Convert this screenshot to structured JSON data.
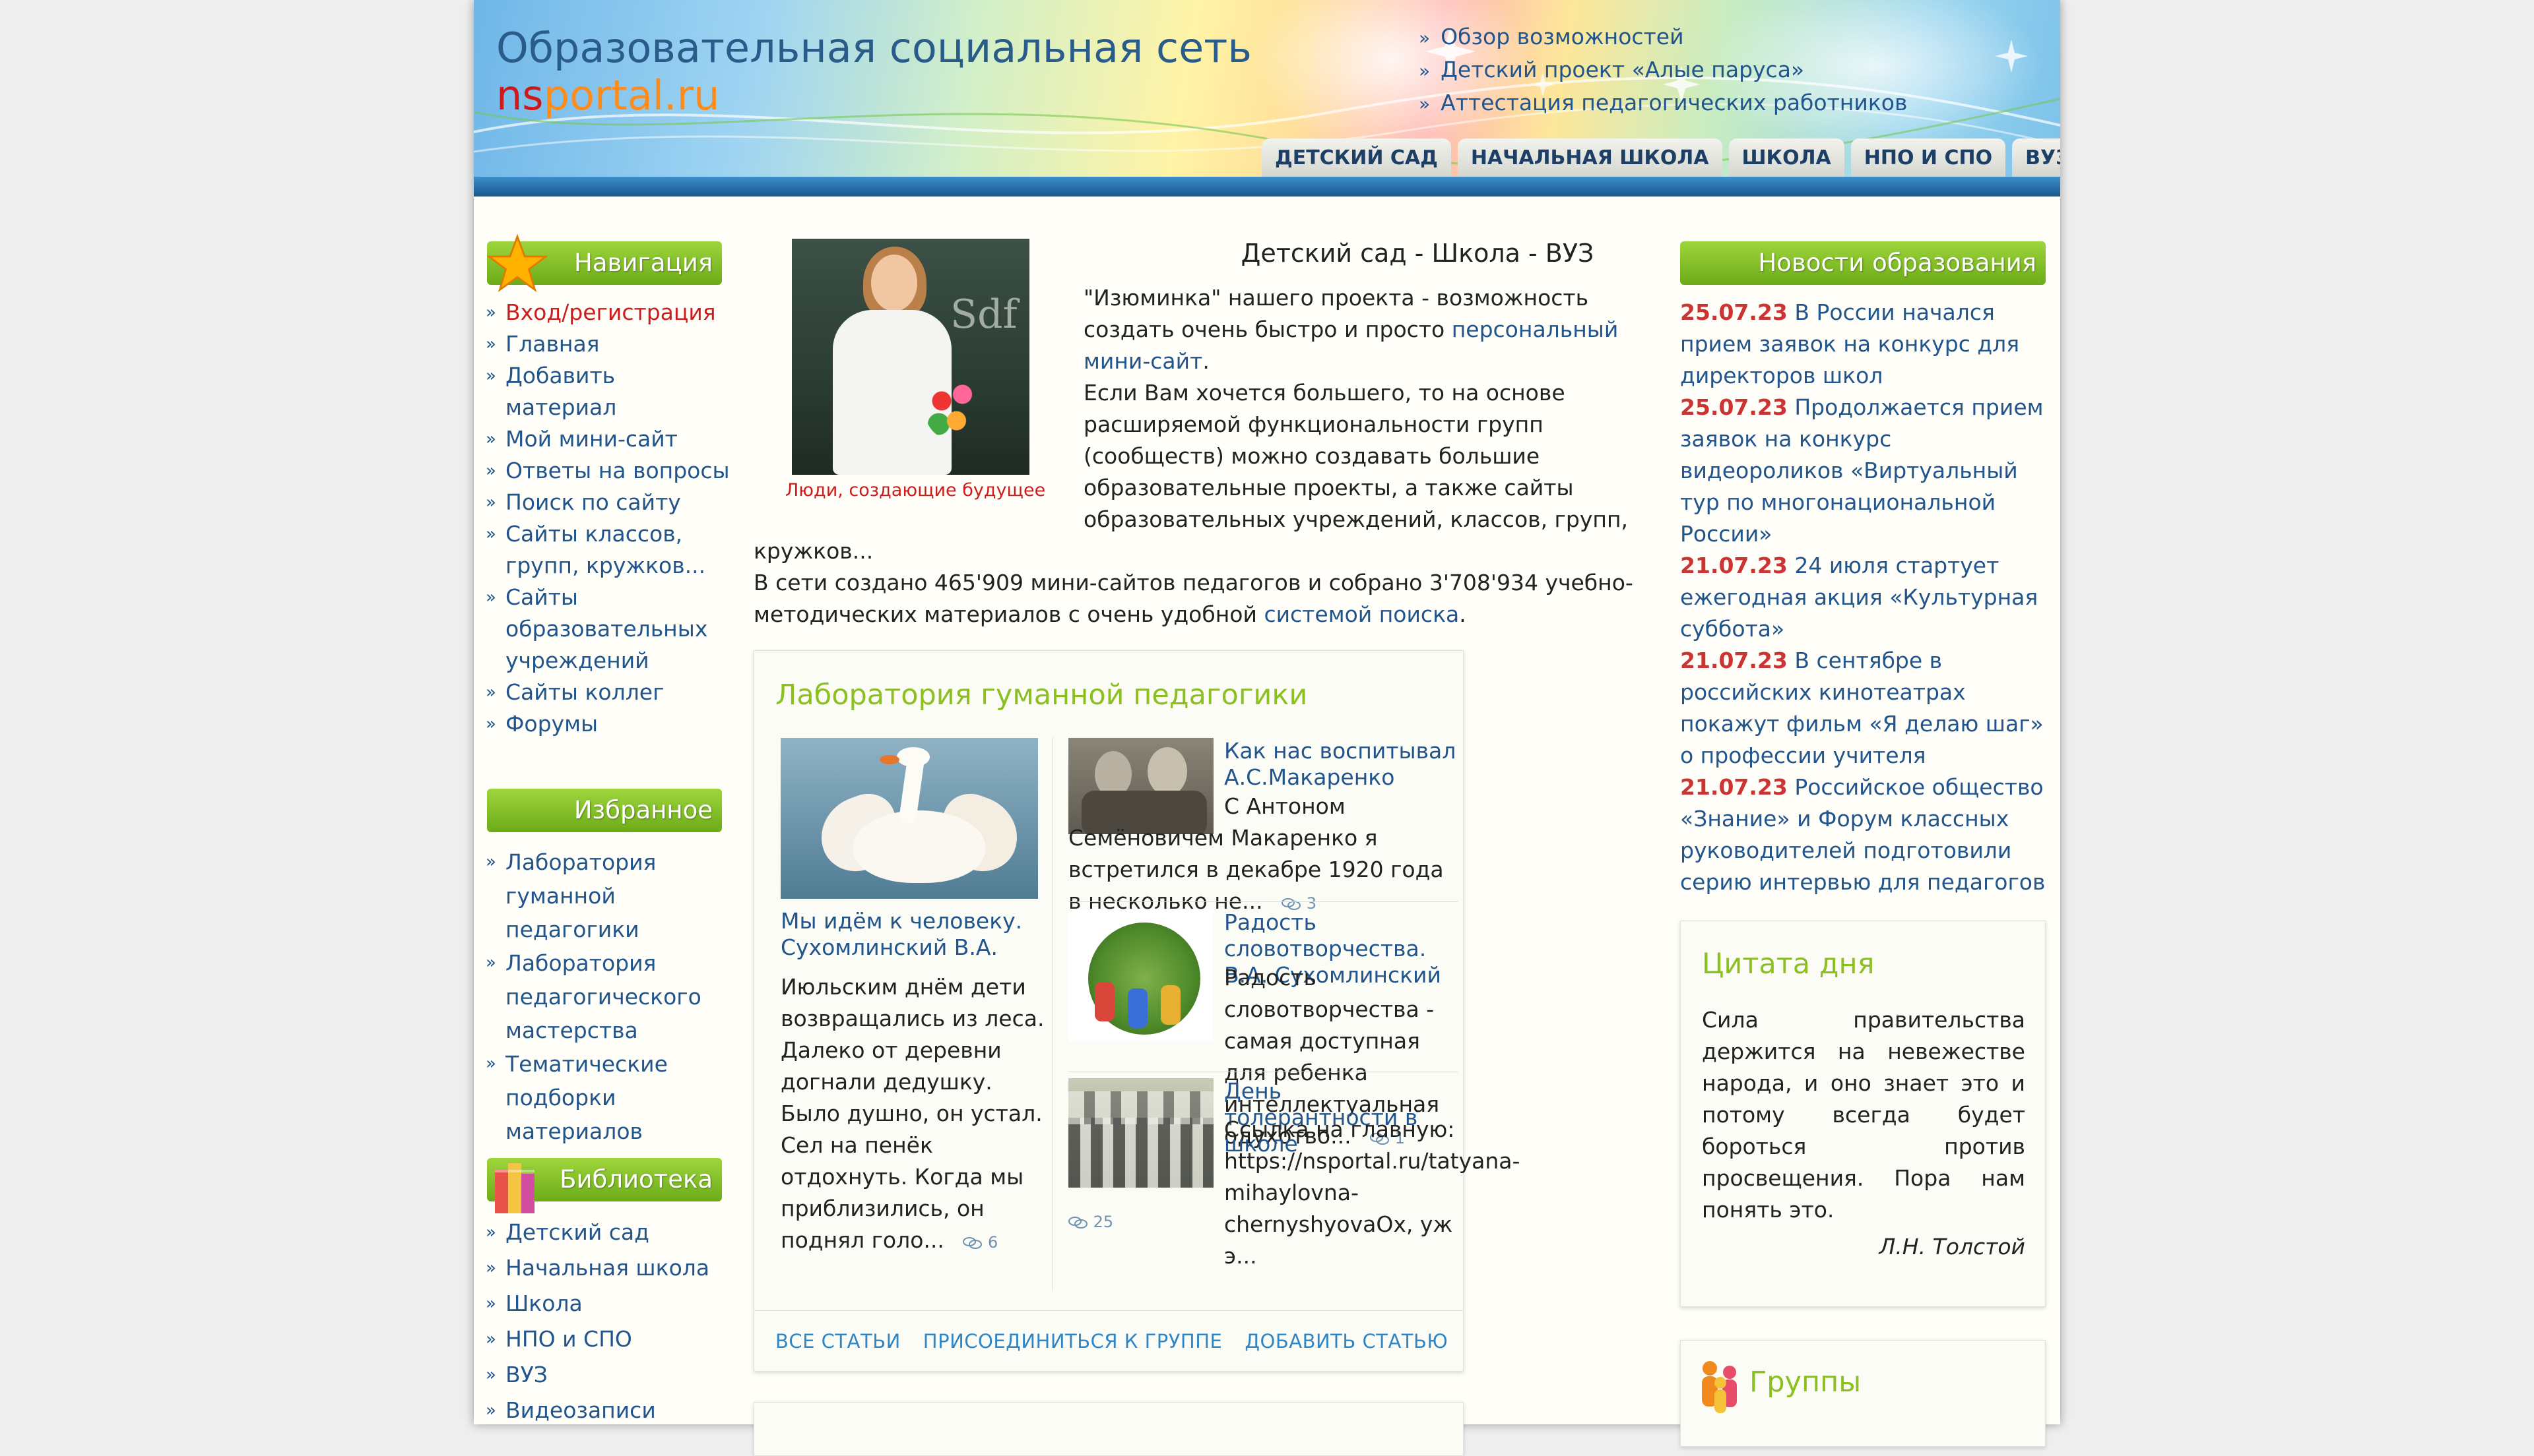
{
  "header": {
    "title": "Образовательная социальная сеть",
    "domain_ns": "ns",
    "domain_portal": "portal.ru",
    "links": [
      "Обзор возможностей",
      "Детский проект «Алые паруса»",
      "Аттестация педагогических работников"
    ],
    "tabs": [
      "ДЕТСКИЙ САД",
      "НАЧАЛЬНАЯ ШКОЛА",
      "ШКОЛА",
      "НПО И СПО",
      "ВУЗ"
    ]
  },
  "sidebar": {
    "nav_title": "Навигация",
    "nav_items": [
      "Вход/регистрация",
      "Главная",
      "Добавить материал",
      "Мой мини-сайт",
      "Ответы на вопросы",
      "Поиск по сайту",
      "Сайты классов, групп, кружков...",
      "Сайты образовательных учреждений",
      "Сайты коллег",
      "Форумы"
    ],
    "fav_title": "Избранное",
    "fav_items": [
      "Лаборатория гуманной педагогики",
      "Лаборатория педагогического мастерства",
      "Тематические подборки материалов"
    ],
    "lib_title": "Библиотека",
    "lib_items": [
      "Детский сад",
      "Начальная школа",
      "Школа",
      "НПО и СПО",
      "ВУЗ",
      "Видеозаписи"
    ]
  },
  "intro": {
    "photo_caption": "Люди, создающие будущее",
    "title": "Детский сад - Школа - ВУЗ",
    "p1_a": "\"Изюминка\" нашего проекта - возможность",
    "p1_b": "создать очень быстро и просто",
    "p1_link": "персональный",
    "p1_link2": "мини-сайт",
    "p1_end": ".",
    "p2_1": "Если Вам хочется большего, то на основе",
    "p2_2": "расширяемой функциональности групп",
    "p2_3": "(сообществ) можно создавать большие",
    "p2_4": "образовательные проекты, а также сайты",
    "p2_5": "образовательных учреждений, классов, групп,",
    "p2_6": "кружков...",
    "p3_1": "В сети создано 465'909 мини-сайтов педагогов и собрано 3'708'934 учебно-",
    "p3_2": "методических материалов с очень удобной",
    "p3_link": "системой поиска",
    "p3_end": "."
  },
  "lab": {
    "title": "Лаборатория гуманной педагогики",
    "main_title": "Мы идём к человеку. Сухомлинский В.А.",
    "main_text": "Июльским днём дети возвращались из леса. Далеко от деревни догнали дедушку. Было душно, он устал. Сел на пенёк отдохнуть. Когда мы приблизились, он поднял голо...",
    "main_comments": "6",
    "articles": [
      {
        "title": "Как нас воспитывал А.С.Макаренко",
        "text": "С Антоном Семёновичем Макаренко я встретился в декабре 1920 года в несколько не...",
        "comments": "3"
      },
      {
        "title": "Радость словотворчества. В.А. Сухомлинский",
        "text": "Радость словотворчества - самая доступная для ребенка интеллектуальная одухотво...",
        "comments": "1"
      },
      {
        "title": "День толерантности в школе",
        "text": " Ссылка на главную: https://nsportal.ru/tatyana-mihaylovna-chernyshyovaOx, уж э...",
        "comments": "25"
      }
    ],
    "links": [
      "ВСЕ СТАТЬИ",
      "ПРИСОЕДИНИТЬСЯ К ГРУППЕ",
      "ДОБАВИТЬ СТАТЬЮ"
    ]
  },
  "news": {
    "title": "Новости образования",
    "items": [
      {
        "date": "25.07.23",
        "text": "В России начался прием заявок на конкурс для директоров школ"
      },
      {
        "date": "25.07.23",
        "text": "Продолжается прием заявок на конкурс видеороликов «Виртуальный тур по многонациональной России»"
      },
      {
        "date": "21.07.23",
        "text": "24 июля стартует ежегодная акция «Культурная суббота»"
      },
      {
        "date": "21.07.23",
        "text": "В сентябре в российских кинотеатрах покажут фильм «Я делаю шаг» о профессии учителя"
      },
      {
        "date": "21.07.23",
        "text": "Российское общество «Знание» и Форум классных руководителей подготовили серию интервью для педагогов"
      }
    ]
  },
  "quote": {
    "title": "Цитата дня",
    "text": "Сила правительства держится на невежестве народа, и оно знает это и потому всегда будет бороться против просвещения. Пора нам понять это.",
    "author": "Л.Н. Толстой"
  },
  "groups": {
    "title": "Группы"
  },
  "colors": {
    "accent_green": "#8cbf20",
    "link_blue": "#22558c",
    "date_red": "#cc3333",
    "header_bar": "#17588f"
  }
}
